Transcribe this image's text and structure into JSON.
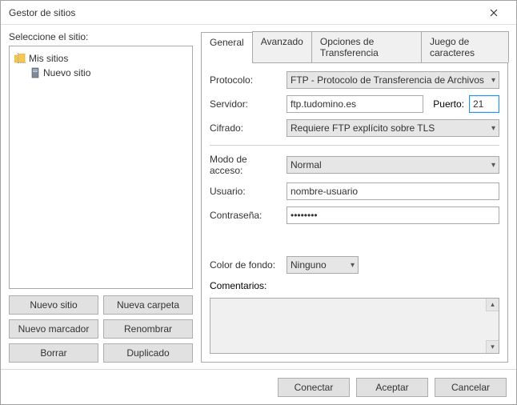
{
  "window": {
    "title": "Gestor de sitios"
  },
  "left": {
    "heading": "Seleccione el sitio:",
    "tree": {
      "root": "Mis sitios",
      "child": "Nuevo sitio"
    },
    "buttons": {
      "new_site": "Nuevo sitio",
      "new_folder": "Nueva carpeta",
      "new_bookmark": "Nuevo marcador",
      "rename": "Renombrar",
      "delete": "Borrar",
      "duplicate": "Duplicado"
    }
  },
  "tabs": {
    "general": "General",
    "advanced": "Avanzado",
    "transfer": "Opciones de Transferencia",
    "charset": "Juego de caracteres"
  },
  "form": {
    "protocol_label": "Protocolo:",
    "protocol_value": "FTP - Protocolo de Transferencia de Archivos",
    "server_label": "Servidor:",
    "server_value": "ftp.tudomino.es",
    "port_label": "Puerto:",
    "port_value": "21",
    "encryption_label": "Cifrado:",
    "encryption_value": "Requiere FTP explícito sobre TLS",
    "access_label": "Modo de acceso:",
    "access_value": "Normal",
    "user_label": "Usuario:",
    "user_value": "nombre-usuario",
    "password_label": "Contraseña:",
    "password_value": "••••••••",
    "bgcolor_label": "Color de fondo:",
    "bgcolor_value": "Ninguno",
    "comments_label": "Comentarios:"
  },
  "footer": {
    "connect": "Conectar",
    "accept": "Aceptar",
    "cancel": "Cancelar"
  }
}
